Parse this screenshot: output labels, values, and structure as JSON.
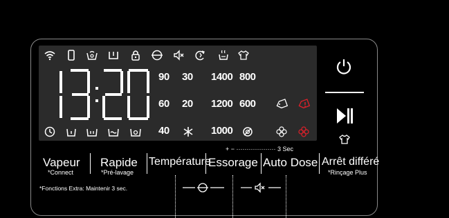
{
  "display": {
    "time": "13:20",
    "temperature_values": [
      "90",
      "60",
      "40"
    ],
    "temperature_values_2": [
      "30",
      "20"
    ],
    "spin_values": [
      "1400",
      "1200",
      "1000"
    ],
    "spin_values_2": [
      "800",
      "600"
    ]
  },
  "buttons": {
    "vapeur": {
      "label": "Vapeur",
      "sub": "*Connect"
    },
    "rapide": {
      "label": "Rapide",
      "sub": "*Pré-lavage"
    },
    "temperature": {
      "label": "Température"
    },
    "essorage": {
      "label": "Essorage"
    },
    "auto_dose": {
      "label": "Auto Dose"
    },
    "arret_differe": {
      "label": "Arrêt différé",
      "sub": "*Rinçage Plus"
    }
  },
  "hints": {
    "auto_dose_hint": "+ − ··················· 3 Sec",
    "extra_functions": "*Fonctions Extra: Maintenir 3 sec."
  },
  "colors": {
    "background": "#000000",
    "display_bg": "#2b2b2b",
    "accent_red": "#e0202a",
    "border": "#8a8a8a"
  },
  "icons": {
    "top_row": [
      "wifi-icon",
      "phone-icon",
      "tub-clean-icon",
      "basin-icon",
      "lock-icon",
      "steam-drum-icon",
      "mute-icon",
      "eco-icon",
      "soak-icon",
      "shirt-icon"
    ],
    "bottom_row": [
      "clock-icon",
      "prewash-icon",
      "mainwash-icon",
      "rinse-icon",
      "spin-icon"
    ],
    "right_status": [
      "detergent-tag-icon",
      "detergent-alert-icon",
      "fluff-icon",
      "fluff-alert-icon"
    ]
  }
}
